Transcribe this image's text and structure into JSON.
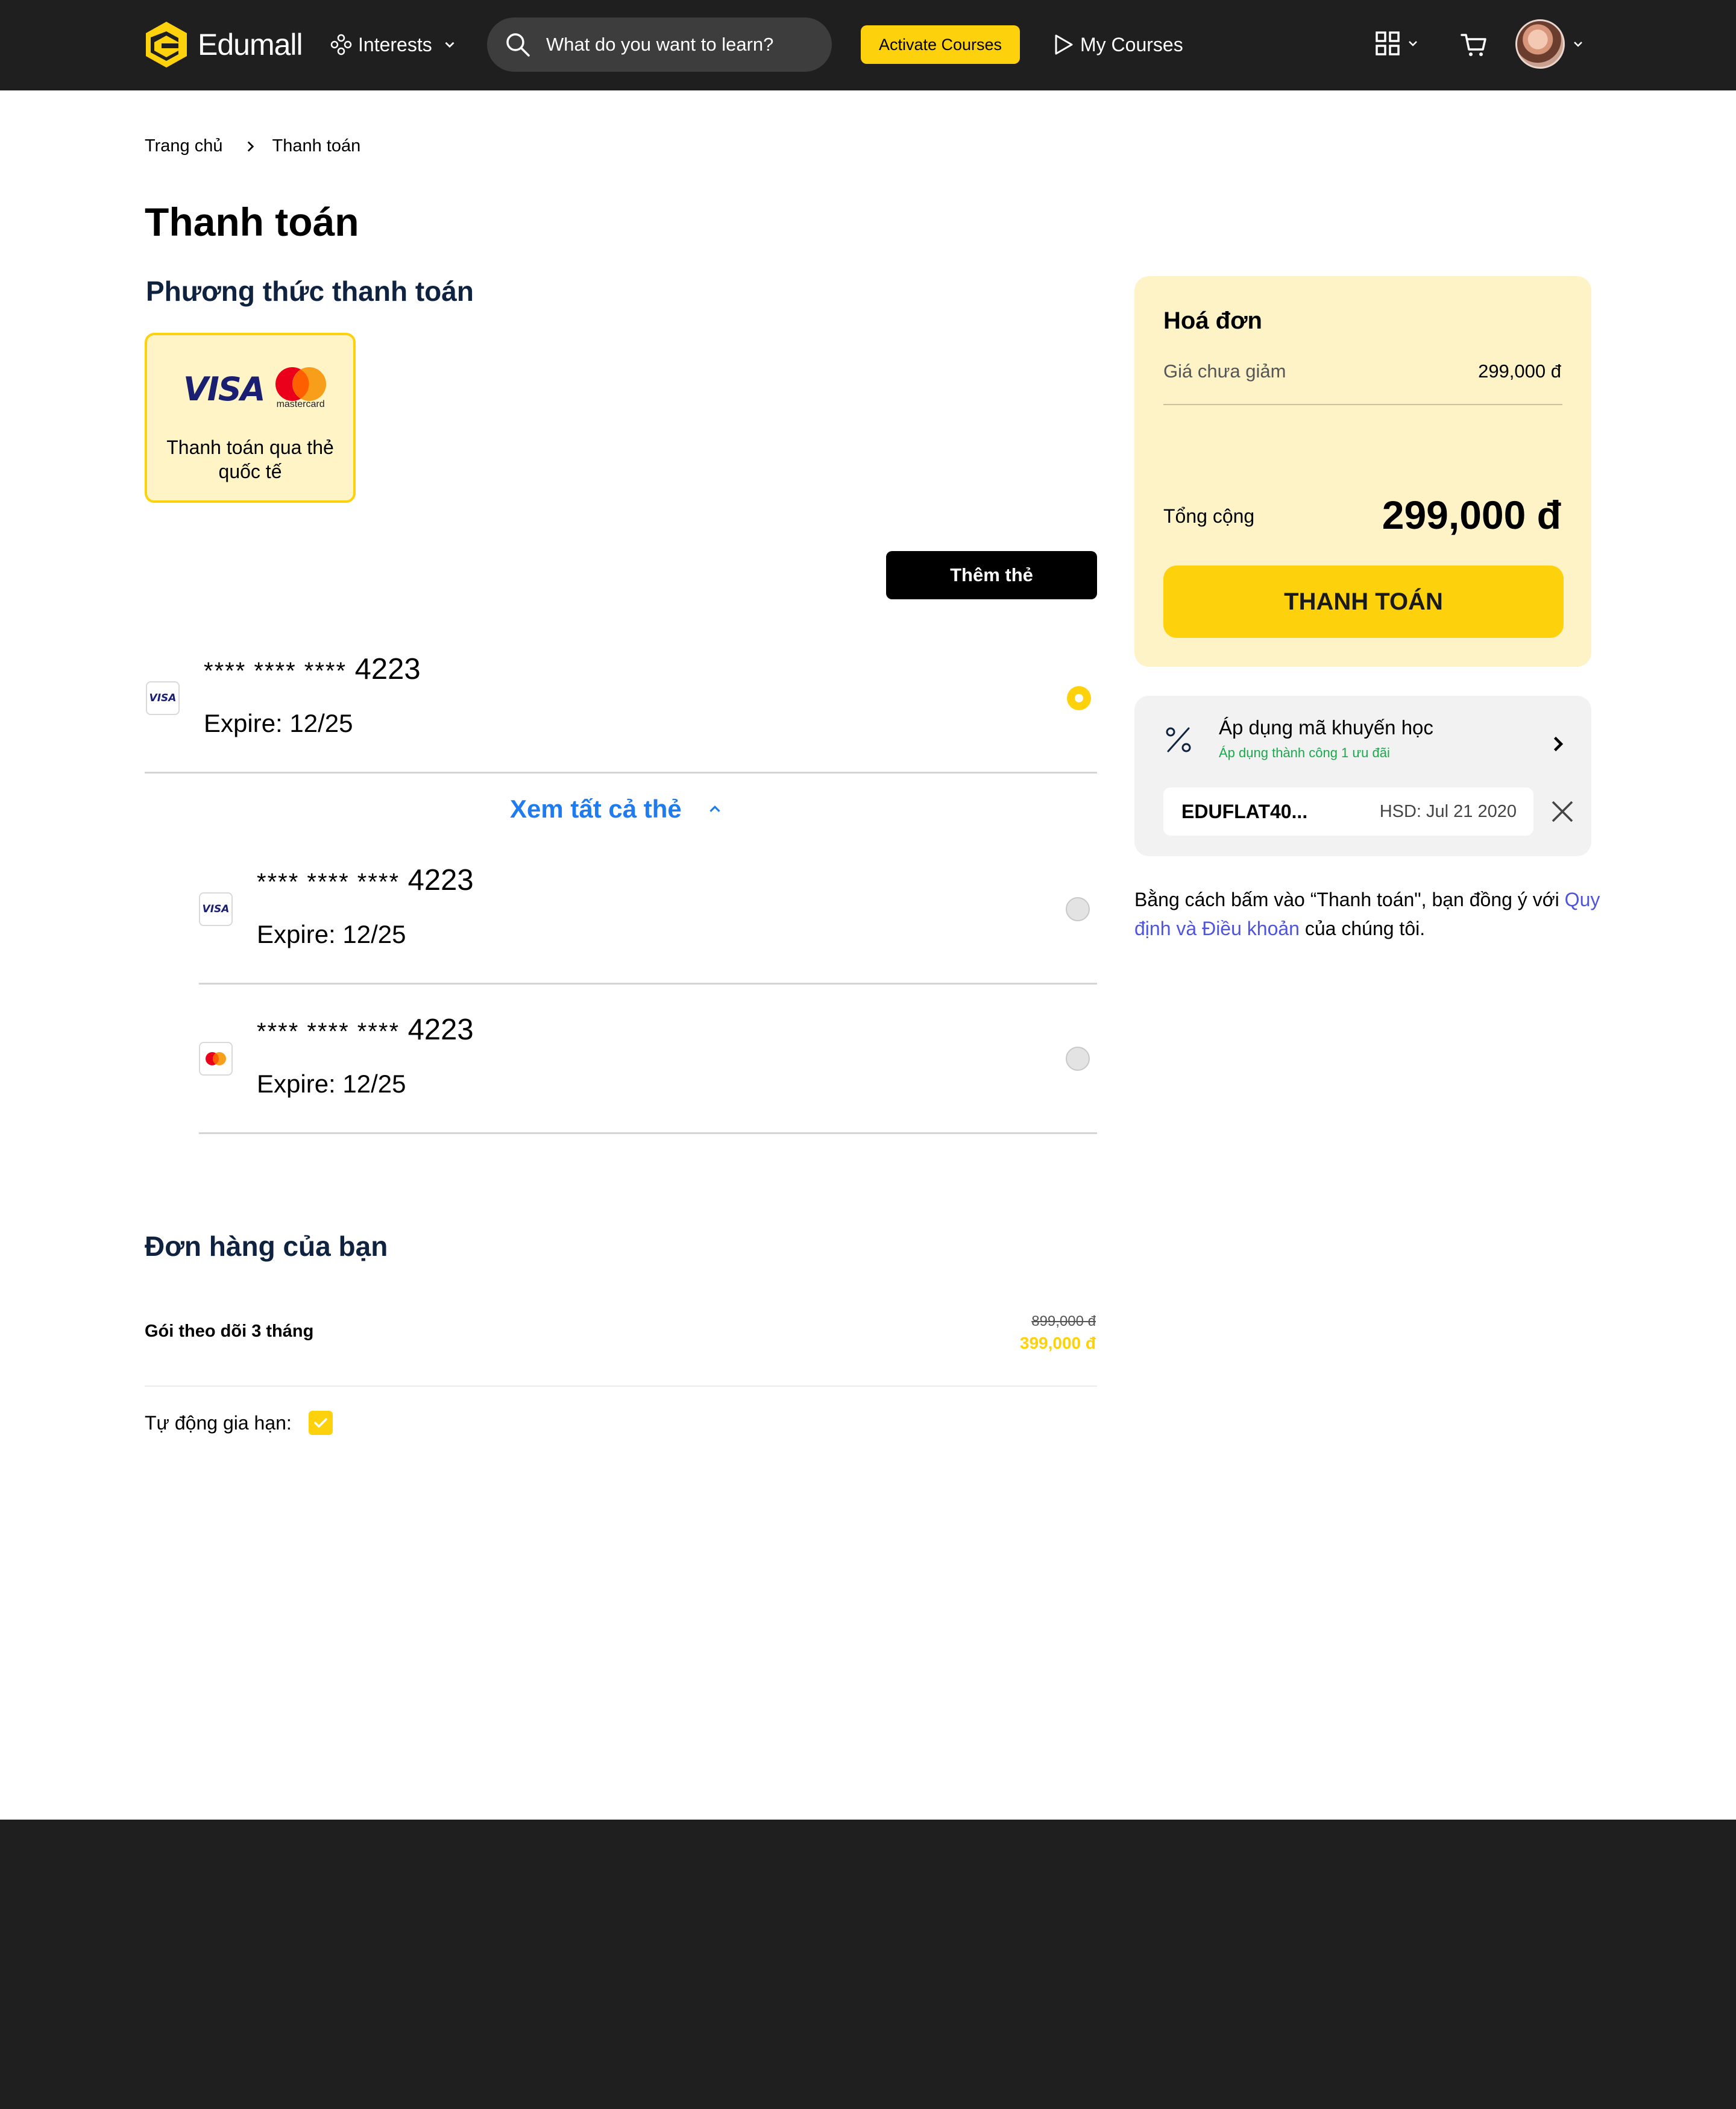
{
  "header": {
    "logo_text": "Edumall",
    "interests_label": "Interests",
    "search_placeholder": "What do you want to learn?",
    "activate_label": "Activate Courses",
    "my_courses_label": "My Courses"
  },
  "breadcrumb": {
    "home": "Trang chủ",
    "current": "Thanh toán"
  },
  "page_title": "Thanh toán",
  "payment_method": {
    "heading": "Phương thức thanh toán",
    "option_label": "Thanh toán qua thẻ quốc tế",
    "visa_text": "VISA",
    "mastercard_text": "mastercard",
    "add_card_label": "Thêm thẻ"
  },
  "cards": [
    {
      "brand": "visa",
      "brand_text": "VISA",
      "masked": "**** **** ****",
      "last4": "4223",
      "expire": "Expire: 12/25",
      "selected": true
    },
    {
      "brand": "visa",
      "brand_text": "VISA",
      "masked": "**** **** ****",
      "last4": "4223",
      "expire": "Expire: 12/25",
      "selected": false
    },
    {
      "brand": "mastercard",
      "brand_text": "",
      "masked": "**** **** ****",
      "last4": "4223",
      "expire": "Expire: 12/25",
      "selected": false
    }
  ],
  "see_all_label": "Xem tất cả thẻ",
  "order": {
    "heading": "Đơn hàng của bạn",
    "item_name": "Gói theo dõi 3 tháng",
    "old_price": "899,000 đ",
    "new_price": "399,000 đ",
    "auto_renew_label": "Tự động gia hạn:",
    "auto_renew": true
  },
  "invoice": {
    "title": "Hoá đơn",
    "subtotal_label": "Giá chưa giảm",
    "subtotal_value": "299,000 đ",
    "total_label": "Tổng cộng",
    "total_value": "299,000 đ",
    "pay_label": "THANH TOÁN"
  },
  "promo": {
    "title": "Áp dụng mã khuyến học",
    "status": "Áp dụng thành công 1 ưu đãi",
    "code": "EDUFLAT40...",
    "expiry": "HSD: Jul 21 2020"
  },
  "terms": {
    "prefix": "Bằng cách bấm vào “Thanh toán\", bạn đồng ý với ",
    "link": "Quy định và Điều khoản",
    "suffix": " của chúng tôi."
  },
  "colors": {
    "accent": "#fdd10c",
    "dark": "#1f1f1f",
    "link": "#1e7cf0",
    "success": "#1aa84d",
    "heading": "#0f2340"
  }
}
